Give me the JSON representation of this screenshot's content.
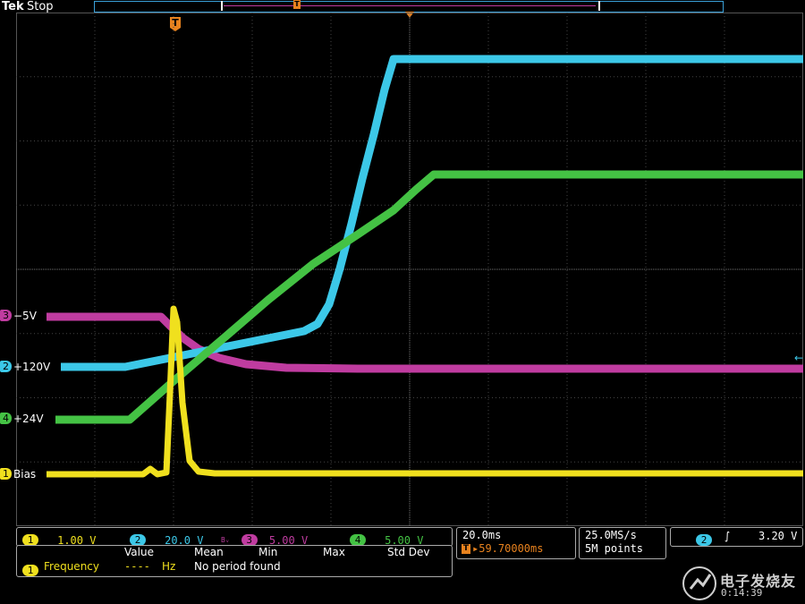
{
  "header": {
    "brand": "Tek",
    "status": "Stop",
    "trigger_glyph": "T"
  },
  "channels": {
    "ch1": {
      "number": "1",
      "label": "Bias",
      "color": "#f0e01e",
      "scale": "1.00 V"
    },
    "ch2": {
      "number": "2",
      "label": "+120V",
      "color": "#3cc8e8",
      "scale": "20.0 V"
    },
    "ch3": {
      "number": "3",
      "label": "−5V",
      "color": "#c03ca0",
      "scale": "5.00 V",
      "bw_glyph": "Bᵥ"
    },
    "ch4": {
      "number": "4",
      "label": "+24V",
      "color": "#44c244",
      "scale": "5.00 V"
    }
  },
  "measurements": {
    "headers": [
      "Value",
      "Mean",
      "Min",
      "Max",
      "Std Dev"
    ],
    "row": {
      "channel": "1",
      "name": "Frequency",
      "value": "----",
      "unit": "Hz",
      "message": "No period found"
    }
  },
  "timebase": {
    "scale": "20.0ms",
    "trigger_delay": "▸59.70000ms"
  },
  "acquisition": {
    "sample_rate": "25.0MS/s",
    "record_length": "5M points"
  },
  "trigger": {
    "channel": "2",
    "slope_glyph": "∫",
    "level": "3.20 V"
  },
  "watermark": {
    "brand": "电子发烧友",
    "time": "0:14:39"
  },
  "accent_colors": {
    "trigger": "#e8821e",
    "frame": "#3aa0d8"
  }
}
